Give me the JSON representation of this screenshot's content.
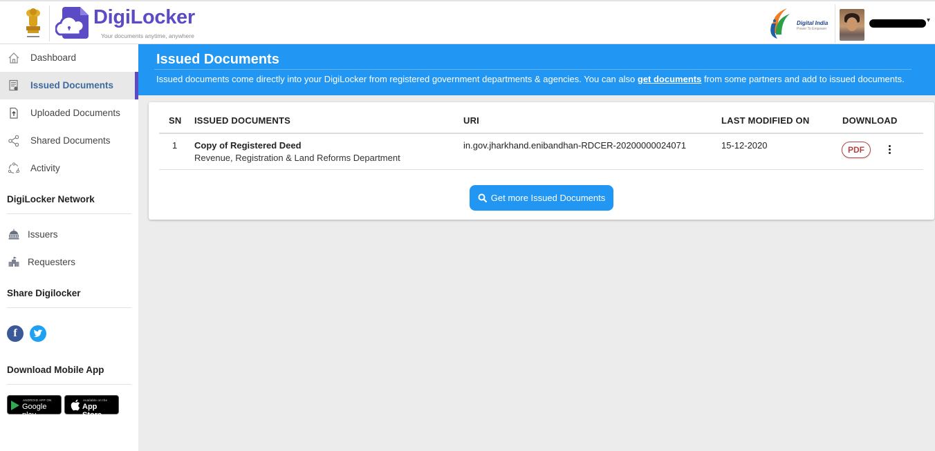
{
  "header": {
    "brand_name": "DigiLocker",
    "brand_tagline": "Your documents anytime, anywhere",
    "emblem_caption": "सत्यमेव जयते",
    "partner_logo_title": "Digital India",
    "partner_logo_subtitle": "Power To Empower",
    "user_menu_caret": "▾"
  },
  "sidebar": {
    "nav": [
      {
        "label": "Dashboard",
        "icon": "home-icon"
      },
      {
        "label": "Issued Documents",
        "icon": "certificate-icon",
        "active": true
      },
      {
        "label": "Uploaded Documents",
        "icon": "file-upload-icon"
      },
      {
        "label": "Shared Documents",
        "icon": "share-icon"
      },
      {
        "label": "Activity",
        "icon": "activity-icon"
      }
    ],
    "network_title": "DigiLocker Network",
    "network_items": [
      {
        "label": "Issuers",
        "icon": "government-building-icon"
      },
      {
        "label": "Requesters",
        "icon": "institution-icon"
      }
    ],
    "share_title": "Share Digilocker",
    "social": {
      "facebook": "f",
      "twitter": "t"
    },
    "download_title": "Download Mobile App",
    "stores": {
      "google_small": "ANDROID APP ON",
      "google_big": "Google play",
      "apple_small": "Available on the",
      "apple_big": "App Store"
    }
  },
  "main": {
    "title": "Issued Documents",
    "description_before": "Issued documents come directly into your DigiLocker from registered government departments & agencies. You can also ",
    "description_link": "get documents",
    "description_after": " from some partners and add to issued documents.",
    "table": {
      "columns": [
        "SN",
        "ISSUED DOCUMENTS",
        "URI",
        "LAST MODIFIED ON",
        "DOWNLOAD"
      ],
      "rows": [
        {
          "sn": "1",
          "doc_name": "Copy of Registered Deed",
          "issuer": "Revenue, Registration & Land Reforms Department",
          "uri": "in.gov.jharkhand.enibandhan-RDCER-20200000024071",
          "last_modified": "15-12-2020",
          "download_label": "PDF"
        }
      ]
    },
    "more_button_label": "Get more Issued Documents"
  },
  "colors": {
    "brand": "#5b4bc4",
    "banner": "#2196f3",
    "pdf": "#b04444"
  }
}
